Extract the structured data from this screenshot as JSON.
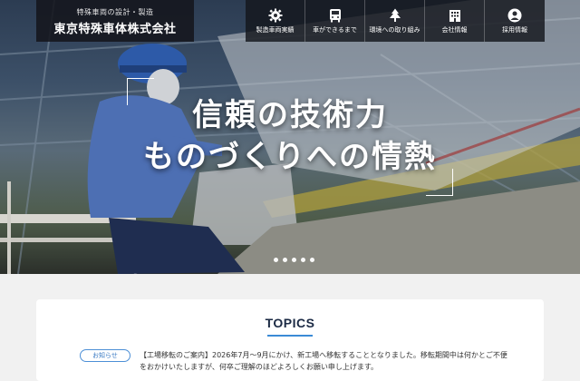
{
  "header": {
    "tagline": "特殊車両の設計・製造",
    "company_name": "東京特殊車体株式会社"
  },
  "nav": [
    {
      "label": "製造車両実績",
      "icon": "gear-icon"
    },
    {
      "label": "車ができるまで",
      "icon": "bus-icon"
    },
    {
      "label": "環境への取り組み",
      "icon": "tree-icon"
    },
    {
      "label": "会社情報",
      "icon": "building-icon"
    },
    {
      "label": "採用情報",
      "icon": "person-icon"
    }
  ],
  "hero": {
    "headline_line1": "信頼の技術力",
    "headline_line2": "ものづくりへの情熱",
    "slide_count": 5
  },
  "topics": {
    "title": "TOPICS",
    "items": [
      {
        "badge": "お知らせ",
        "text": "【工場移転のご案内】2026年7月～9月にかけ、新工場へ移転することとなりました。移転期間中は何かとご不便をおかけいたしますが、何卒ご理解のほどよろしくお願い申し上げます。"
      }
    ]
  },
  "colors": {
    "accent": "#3b8bd6",
    "header_bg": "#14161c",
    "title": "#1b2a44"
  }
}
